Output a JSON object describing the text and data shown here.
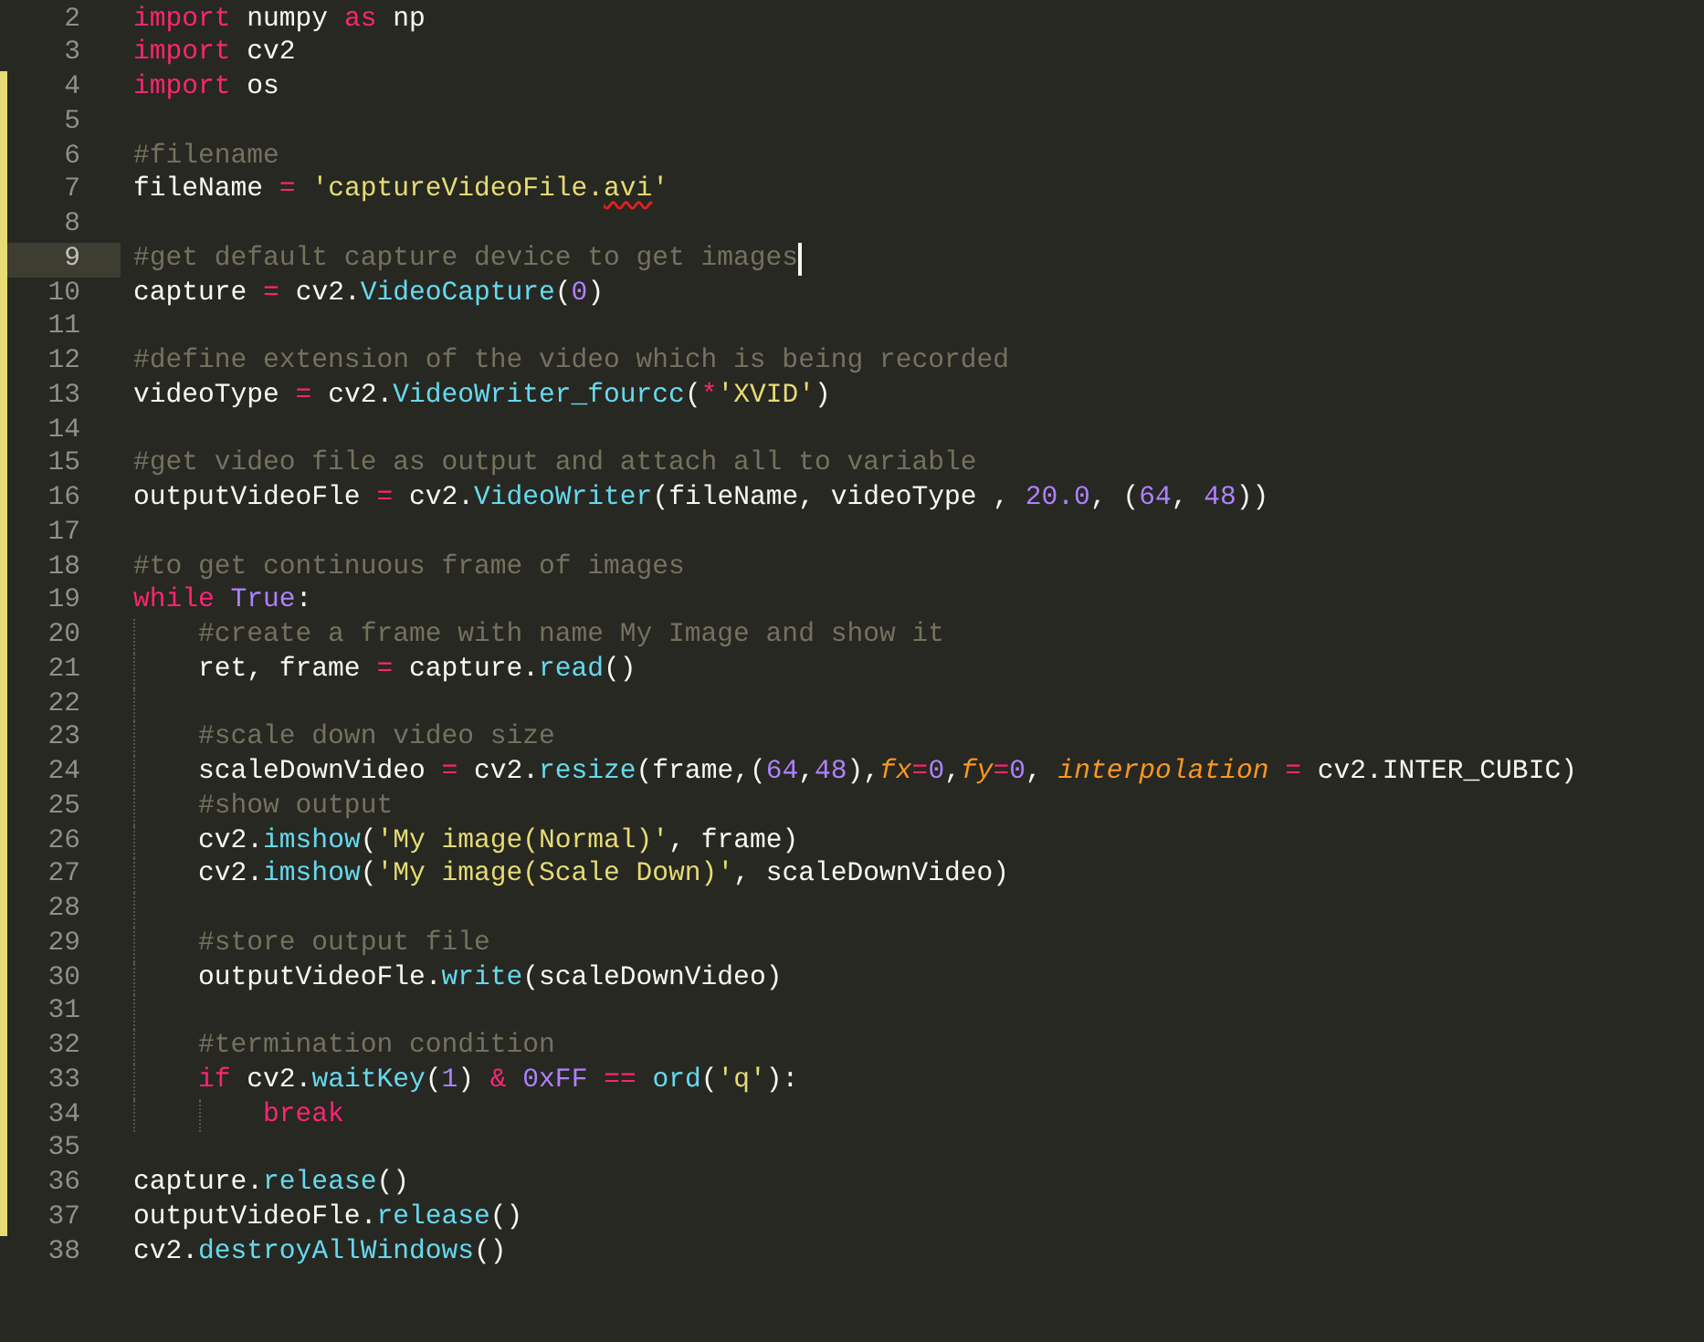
{
  "editor": {
    "lines": [
      {
        "number": "2",
        "modified": false,
        "selected": false,
        "tokens": [
          {
            "kind": "keyword",
            "text": "import"
          },
          {
            "kind": "plain",
            "text": " numpy "
          },
          {
            "kind": "keyword",
            "text": "as"
          },
          {
            "kind": "plain",
            "text": " np"
          }
        ]
      },
      {
        "number": "3",
        "modified": false,
        "selected": false,
        "tokens": [
          {
            "kind": "keyword",
            "text": "import"
          },
          {
            "kind": "plain",
            "text": " cv2"
          }
        ]
      },
      {
        "number": "4",
        "modified": true,
        "selected": false,
        "tokens": [
          {
            "kind": "keyword",
            "text": "import"
          },
          {
            "kind": "plain",
            "text": " os"
          }
        ]
      },
      {
        "number": "5",
        "modified": true,
        "selected": false
      },
      {
        "number": "6",
        "modified": true,
        "selected": false,
        "tokens": [
          {
            "kind": "comment",
            "text": "#filename"
          }
        ]
      },
      {
        "number": "7",
        "modified": true,
        "selected": false,
        "tokens": [
          {
            "kind": "plain",
            "text": "fileName "
          },
          {
            "kind": "keyword",
            "text": "="
          },
          {
            "kind": "string",
            "text": " 'captureVideoFile."
          },
          {
            "kind": "misspelled",
            "text": "avi"
          },
          {
            "kind": "string",
            "text": "'"
          }
        ]
      },
      {
        "number": "8",
        "modified": true,
        "selected": false
      },
      {
        "number": "9",
        "modified": true,
        "selected": true,
        "tokens": [
          {
            "kind": "comment",
            "text": "#get default capture device to get images"
          }
        ]
      },
      {
        "number": "10",
        "modified": true,
        "selected": false,
        "tokens": [
          {
            "kind": "plain",
            "text": "capture "
          },
          {
            "kind": "keyword",
            "text": "="
          },
          {
            "kind": "plain",
            "text": " cv2."
          },
          {
            "kind": "function",
            "text": "VideoCapture"
          },
          {
            "kind": "plain",
            "text": "("
          },
          {
            "kind": "number",
            "text": "0"
          },
          {
            "kind": "plain",
            "text": ")"
          }
        ]
      },
      {
        "number": "11",
        "modified": true,
        "selected": false
      },
      {
        "number": "12",
        "modified": true,
        "selected": false,
        "tokens": [
          {
            "kind": "comment",
            "text": "#define extension of the video which is being recorded"
          }
        ]
      },
      {
        "number": "13",
        "modified": true,
        "selected": false,
        "tokens": [
          {
            "kind": "plain",
            "text": "videoType "
          },
          {
            "kind": "keyword",
            "text": "="
          },
          {
            "kind": "plain",
            "text": " cv2."
          },
          {
            "kind": "function",
            "text": "VideoWriter_fourcc"
          },
          {
            "kind": "plain",
            "text": "("
          },
          {
            "kind": "keyword",
            "text": "*"
          },
          {
            "kind": "string",
            "text": "'XVID'"
          },
          {
            "kind": "plain",
            "text": ")"
          }
        ]
      },
      {
        "number": "14",
        "modified": true,
        "selected": false
      },
      {
        "number": "15",
        "modified": true,
        "selected": false,
        "tokens": [
          {
            "kind": "comment",
            "text": "#get video file as output and attach all to variable"
          }
        ]
      },
      {
        "number": "16",
        "modified": true,
        "selected": false,
        "tokens": [
          {
            "kind": "plain",
            "text": "outputVideoFle "
          },
          {
            "kind": "keyword",
            "text": "="
          },
          {
            "kind": "plain",
            "text": " cv2."
          },
          {
            "kind": "function",
            "text": "VideoWriter"
          },
          {
            "kind": "plain",
            "text": "(fileName, videoType , "
          },
          {
            "kind": "number",
            "text": "20.0"
          },
          {
            "kind": "plain",
            "text": ", ("
          },
          {
            "kind": "number",
            "text": "64"
          },
          {
            "kind": "plain",
            "text": ", "
          },
          {
            "kind": "number",
            "text": "48"
          },
          {
            "kind": "plain",
            "text": "))"
          }
        ]
      },
      {
        "number": "17",
        "modified": true,
        "selected": false
      },
      {
        "number": "18",
        "modified": true,
        "selected": false,
        "tokens": [
          {
            "kind": "comment",
            "text": "#to get continuous frame of images"
          }
        ]
      },
      {
        "number": "19",
        "modified": true,
        "selected": false,
        "tokens": [
          {
            "kind": "keyword",
            "text": "while"
          },
          {
            "kind": "number",
            "text": " True"
          },
          {
            "kind": "plain",
            "text": ":"
          }
        ]
      },
      {
        "number": "20",
        "modified": true,
        "selected": false,
        "tokens": [
          {
            "kind": "comment",
            "text": "    #create a frame with name My Image and show it"
          }
        ]
      },
      {
        "number": "21",
        "modified": true,
        "selected": false,
        "tokens": [
          {
            "kind": "plain",
            "text": "    ret, frame "
          },
          {
            "kind": "keyword",
            "text": "="
          },
          {
            "kind": "plain",
            "text": " capture."
          },
          {
            "kind": "function",
            "text": "read"
          },
          {
            "kind": "plain",
            "text": "()"
          }
        ]
      },
      {
        "number": "22",
        "modified": true,
        "selected": false
      },
      {
        "number": "23",
        "modified": true,
        "selected": false,
        "tokens": [
          {
            "kind": "comment",
            "text": "    #scale down video size"
          }
        ]
      },
      {
        "number": "24",
        "modified": true,
        "selected": false,
        "tokens": [
          {
            "kind": "plain",
            "text": "    scaleDownVideo "
          },
          {
            "kind": "keyword",
            "text": "="
          },
          {
            "kind": "plain",
            "text": " cv2."
          },
          {
            "kind": "function",
            "text": "resize"
          },
          {
            "kind": "plain",
            "text": "(frame,("
          },
          {
            "kind": "number",
            "text": "64"
          },
          {
            "kind": "plain",
            "text": ","
          },
          {
            "kind": "number",
            "text": "48"
          },
          {
            "kind": "plain",
            "text": "),"
          },
          {
            "kind": "parameter",
            "text": "fx"
          },
          {
            "kind": "keyword",
            "text": "="
          },
          {
            "kind": "number",
            "text": "0"
          },
          {
            "kind": "plain",
            "text": ","
          },
          {
            "kind": "parameter",
            "text": "fy"
          },
          {
            "kind": "keyword",
            "text": "="
          },
          {
            "kind": "number",
            "text": "0"
          },
          {
            "kind": "plain",
            "text": ", "
          },
          {
            "kind": "parameter",
            "text": "interpolation "
          },
          {
            "kind": "keyword",
            "text": "="
          },
          {
            "kind": "plain",
            "text": " cv2.INTER_CUBIC)"
          }
        ]
      },
      {
        "number": "25",
        "modified": true,
        "selected": false,
        "tokens": [
          {
            "kind": "comment",
            "text": "    #show output"
          }
        ]
      },
      {
        "number": "26",
        "modified": true,
        "selected": false,
        "tokens": [
          {
            "kind": "plain",
            "text": "    cv2."
          },
          {
            "kind": "function",
            "text": "imshow"
          },
          {
            "kind": "plain",
            "text": "("
          },
          {
            "kind": "string",
            "text": "'My image(Normal)'"
          },
          {
            "kind": "plain",
            "text": ", frame)"
          }
        ]
      },
      {
        "number": "27",
        "modified": true,
        "selected": false,
        "tokens": [
          {
            "kind": "plain",
            "text": "    cv2."
          },
          {
            "kind": "function",
            "text": "imshow"
          },
          {
            "kind": "plain",
            "text": "("
          },
          {
            "kind": "string",
            "text": "'My image(Scale Down)'"
          },
          {
            "kind": "plain",
            "text": ", scaleDownVideo)"
          }
        ]
      },
      {
        "number": "28",
        "modified": true,
        "selected": false
      },
      {
        "number": "29",
        "modified": true,
        "selected": false,
        "tokens": [
          {
            "kind": "comment",
            "text": "    #store output file"
          }
        ]
      },
      {
        "number": "30",
        "modified": true,
        "selected": false,
        "tokens": [
          {
            "kind": "plain",
            "text": "    outputVideoFle."
          },
          {
            "kind": "function",
            "text": "write"
          },
          {
            "kind": "plain",
            "text": "(scaleDownVideo)"
          }
        ]
      },
      {
        "number": "31",
        "modified": true,
        "selected": false
      },
      {
        "number": "32",
        "modified": true,
        "selected": false,
        "tokens": [
          {
            "kind": "comment",
            "text": "    #termination condition"
          }
        ]
      },
      {
        "number": "33",
        "modified": true,
        "selected": false,
        "tokens": [
          {
            "kind": "keyword",
            "text": "    if"
          },
          {
            "kind": "plain",
            "text": " cv2."
          },
          {
            "kind": "function",
            "text": "waitKey"
          },
          {
            "kind": "plain",
            "text": "("
          },
          {
            "kind": "number",
            "text": "1"
          },
          {
            "kind": "plain",
            "text": ") "
          },
          {
            "kind": "keyword",
            "text": "&"
          },
          {
            "kind": "number",
            "text": " 0xFF "
          },
          {
            "kind": "keyword",
            "text": "=="
          },
          {
            "kind": "function",
            "text": " ord"
          },
          {
            "kind": "plain",
            "text": "("
          },
          {
            "kind": "string",
            "text": "'q'"
          },
          {
            "kind": "plain",
            "text": "):"
          }
        ]
      },
      {
        "number": "34",
        "modified": true,
        "selected": false,
        "tokens": [
          {
            "kind": "keyword",
            "text": "        break"
          }
        ]
      },
      {
        "number": "35",
        "modified": true,
        "selected": false
      },
      {
        "number": "36",
        "modified": true,
        "selected": false,
        "tokens": [
          {
            "kind": "plain",
            "text": "capture."
          },
          {
            "kind": "function",
            "text": "release"
          },
          {
            "kind": "plain",
            "text": "()"
          }
        ]
      },
      {
        "number": "37",
        "modified": true,
        "selected": false,
        "tokens": [
          {
            "kind": "plain",
            "text": "outputVideoFle."
          },
          {
            "kind": "function",
            "text": "release"
          },
          {
            "kind": "plain",
            "text": "()"
          }
        ]
      },
      {
        "number": "38",
        "modified": false,
        "selected": false,
        "tokens": [
          {
            "kind": "plain",
            "text": "cv2."
          },
          {
            "kind": "function",
            "text": "destroyAllWindows"
          },
          {
            "kind": "plain",
            "text": "()"
          }
        ]
      }
    ]
  }
}
